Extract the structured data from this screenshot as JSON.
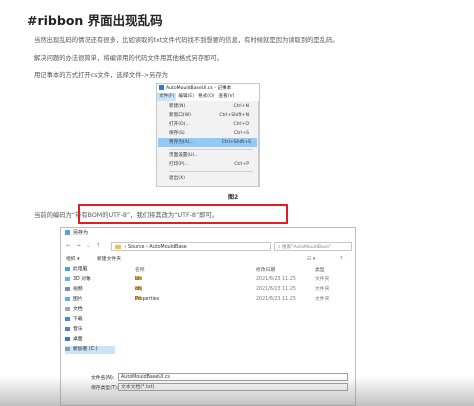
{
  "article": {
    "title": "#ribbon 界面出现乱码",
    "para1": "当然出现乱码的情况还有很多，比如读取的txt文件代码找不到想要的信息，有时候就是因为读取到的是乱码。",
    "para2": "解决问题的办法很简单，将编译用的代码文件用其他格式另存即可。",
    "para3": "用记事本的方式打开cs文件，选择文件->另存为",
    "caption": "图2",
    "para4": "当前的编码为“带有BOM的UTF-8”，我们将其改为“UTF-8”即可。"
  },
  "notepad": {
    "title": "AutoMouldBaseUI.cs - 记事本",
    "menus": [
      "文件(F)",
      "编辑(E)",
      "格式(O)",
      "查看(V)"
    ],
    "items": [
      {
        "label": "新建(N)",
        "shortcut": "Ctrl+N"
      },
      {
        "label": "新窗口(W)",
        "shortcut": "Ctrl+Shift+N"
      },
      {
        "label": "打开(O)...",
        "shortcut": "Ctrl+O"
      },
      {
        "label": "保存(S)",
        "shortcut": "Ctrl+S"
      },
      {
        "label": "另存为(A)...",
        "shortcut": "Ctrl+Shift+S"
      },
      {
        "label": "页面设置(U)...",
        "shortcut": ""
      },
      {
        "label": "打印(P)...",
        "shortcut": "Ctrl+P"
      },
      {
        "label": "退出(X)",
        "shortcut": ""
      }
    ]
  },
  "dialog": {
    "title": "另存为",
    "path": [
      "Source",
      "AutoMouldBase"
    ],
    "search_placeholder": "搜索\"AutoMouldBase\"",
    "organize": "组织 ▾",
    "new_folder": "新建文件夹",
    "sidebar": [
      "此电脑",
      "3D 对象",
      "视频",
      "图片",
      "文档",
      "下载",
      "音乐",
      "桌面",
      "新加卷 (C:)"
    ],
    "columns": {
      "name": "名称",
      "date": "修改日期",
      "type": "类型"
    },
    "files": [
      {
        "name": "bin",
        "date": "2021/6/23 11:25",
        "type": "文件夹"
      },
      {
        "name": "obj",
        "date": "2021/6/23 11:25",
        "type": "文件夹"
      },
      {
        "name": "Properties",
        "date": "2021/6/23 11:25",
        "type": "文件夹"
      }
    ],
    "filename_label": "文件名(N):",
    "filename_value": "AutoMouldBaseUI.cs",
    "type_label": "保存类型(T):",
    "type_value": "文本文档(*.txt)"
  },
  "colors": {
    "highlight_box": "#e02020",
    "menu_highlight": "#91c9f7",
    "folder": "#f0c24c"
  }
}
